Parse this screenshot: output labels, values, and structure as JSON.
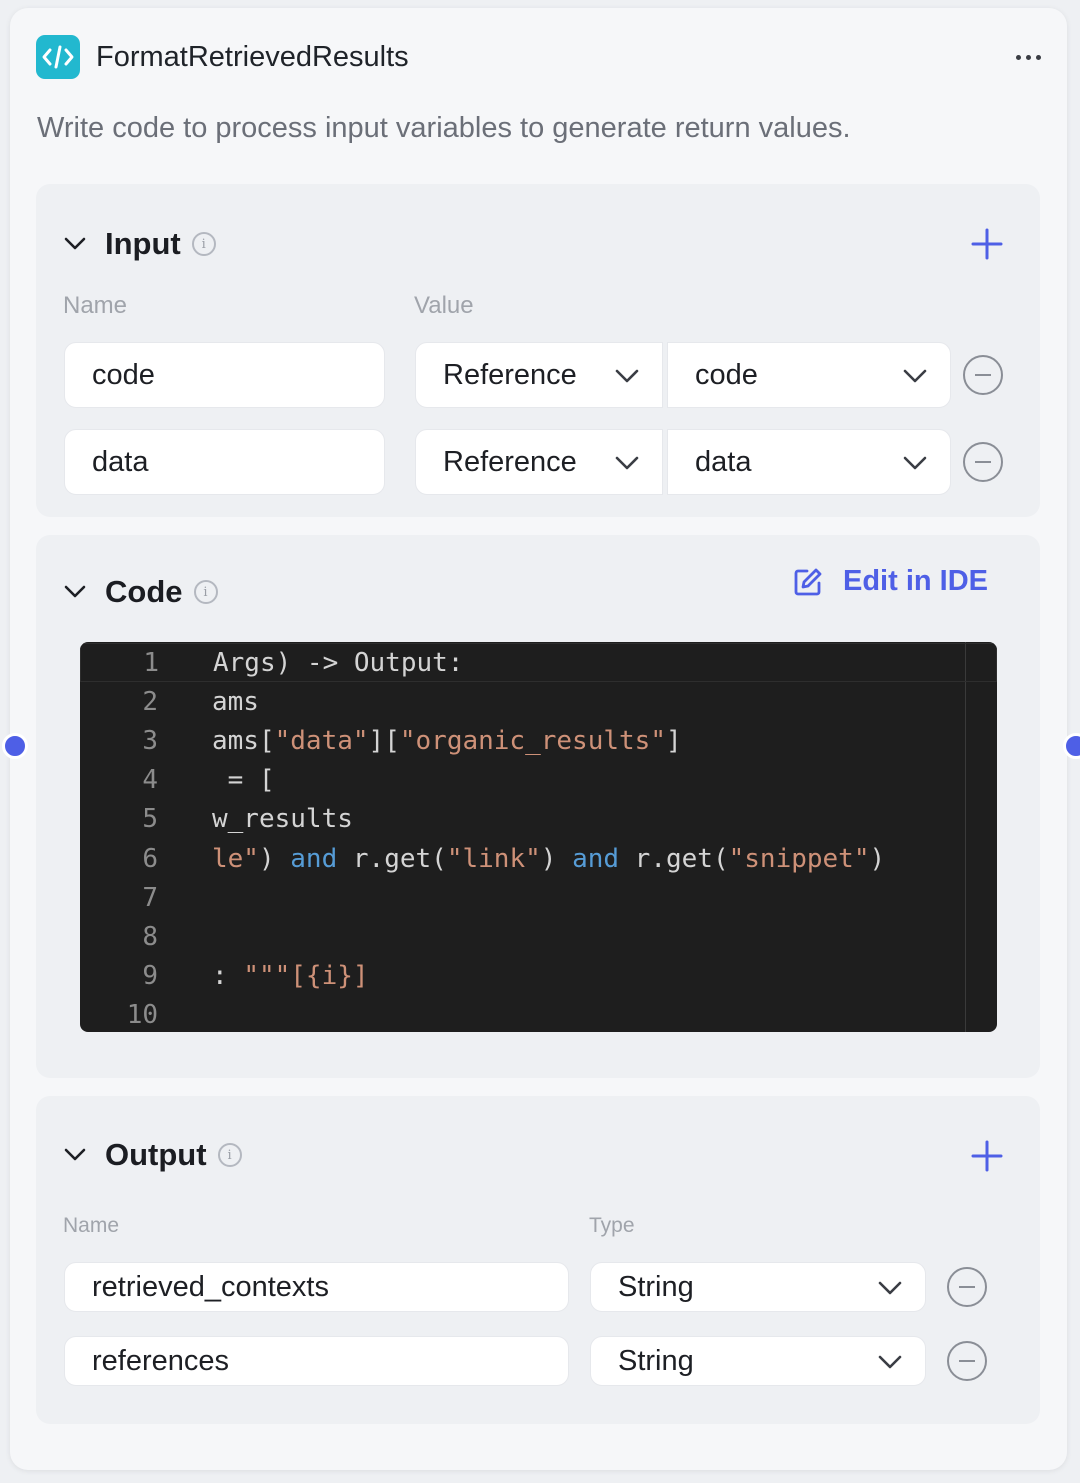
{
  "node": {
    "title": "FormatRetrievedResults",
    "description": "Write code to process input variables to generate return values.",
    "icon": "code-brackets-icon",
    "accent": "#4e5fe6",
    "icon_bg": "#22b8cf"
  },
  "input": {
    "title": "Input",
    "col_name": "Name",
    "col_value": "Value",
    "rows": [
      {
        "name": "code",
        "source": "Reference",
        "ref": "code"
      },
      {
        "name": "data",
        "source": "Reference",
        "ref": "data"
      }
    ]
  },
  "code": {
    "title": "Code",
    "edit_label": "Edit in IDE",
    "lines": [
      {
        "n": "1",
        "tokens": [
          {
            "t": "Args) -> Output:",
            "c": "plain"
          }
        ]
      },
      {
        "n": "2",
        "tokens": [
          {
            "t": "ams",
            "c": "plain"
          }
        ]
      },
      {
        "n": "3",
        "tokens": [
          {
            "t": "ams[",
            "c": "plain"
          },
          {
            "t": "\"data\"",
            "c": "str"
          },
          {
            "t": "][",
            "c": "plain"
          },
          {
            "t": "\"organic_results\"",
            "c": "str"
          },
          {
            "t": "]",
            "c": "plain"
          }
        ]
      },
      {
        "n": "4",
        "tokens": [
          {
            "t": " = [",
            "c": "plain"
          }
        ]
      },
      {
        "n": "5",
        "tokens": [
          {
            "t": "w_results",
            "c": "plain"
          }
        ]
      },
      {
        "n": "6",
        "tokens": [
          {
            "t": "le\"",
            "c": "str"
          },
          {
            "t": ") ",
            "c": "plain"
          },
          {
            "t": "and",
            "c": "kw"
          },
          {
            "t": " r.get(",
            "c": "plain"
          },
          {
            "t": "\"link\"",
            "c": "str"
          },
          {
            "t": ") ",
            "c": "plain"
          },
          {
            "t": "and",
            "c": "kw"
          },
          {
            "t": " r.get(",
            "c": "plain"
          },
          {
            "t": "\"snippet\"",
            "c": "str"
          },
          {
            "t": ")",
            "c": "plain"
          }
        ]
      },
      {
        "n": "7",
        "tokens": []
      },
      {
        "n": "8",
        "tokens": []
      },
      {
        "n": "9",
        "tokens": [
          {
            "t": ": ",
            "c": "plain"
          },
          {
            "t": "\"\"\"[{i}]",
            "c": "str"
          }
        ]
      },
      {
        "n": "10",
        "tokens": []
      }
    ]
  },
  "output": {
    "title": "Output",
    "col_name": "Name",
    "col_type": "Type",
    "rows": [
      {
        "name": "retrieved_contexts",
        "type": "String"
      },
      {
        "name": "references",
        "type": "String"
      }
    ]
  }
}
